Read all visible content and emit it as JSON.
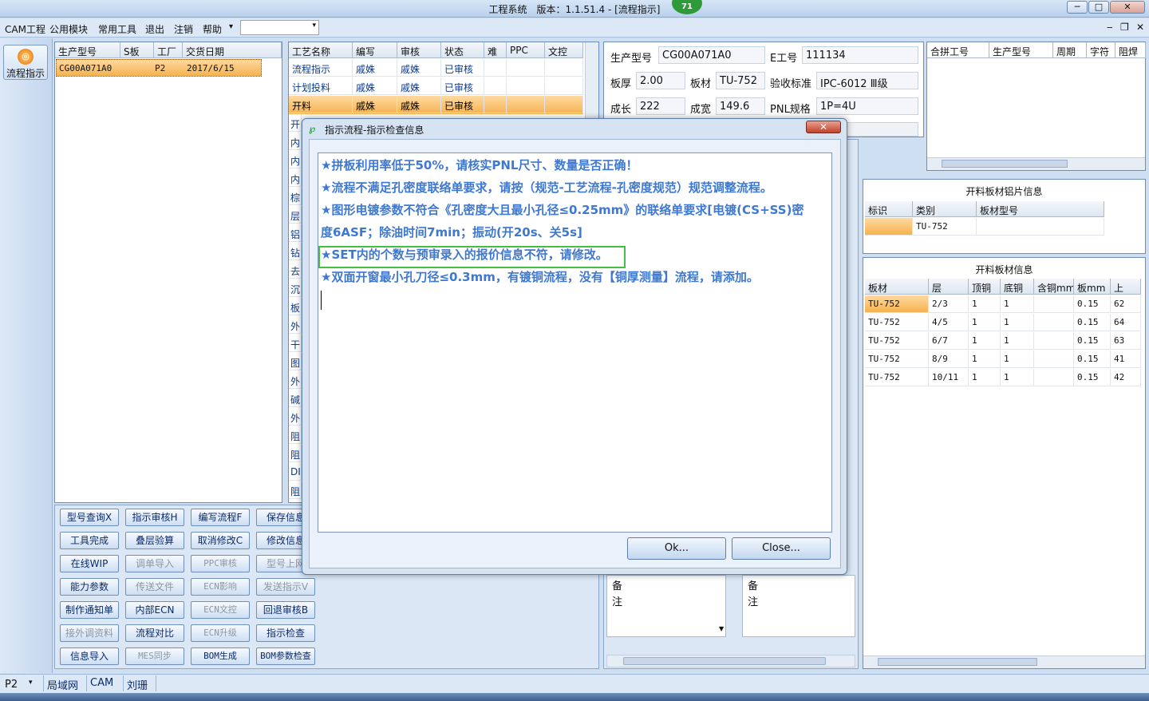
{
  "window": {
    "title": "工程系统　版本：1.1.51.4 - [流程指示]",
    "badge": "71",
    "controls": [
      "─",
      "□",
      "✕"
    ]
  },
  "menubar": {
    "items": [
      "CAM工程",
      "公用模块",
      "常用工具",
      "退出",
      "注销",
      "帮助"
    ],
    "help_arrow": "▾",
    "combo_value": "",
    "mdi_controls": [
      "‒",
      "❐",
      "✕"
    ]
  },
  "sidebar": {
    "flow_button": "流程指示"
  },
  "order_list": {
    "headers": [
      "生产型号",
      "S板",
      "工厂",
      "交货日期"
    ],
    "rows": [
      [
        "CG00A071A0",
        "",
        "P2",
        "2017/6/15"
      ]
    ]
  },
  "process_list": {
    "headers": [
      "工艺名称",
      "编写",
      "审核",
      "状态",
      "难",
      "PPC",
      "文控"
    ],
    "rows": [
      [
        "流程指示",
        "戚姝",
        "戚姝",
        "已审核"
      ],
      [
        "计划投料",
        "戚姝",
        "戚姝",
        "已审核"
      ],
      [
        "开料",
        "戚姝",
        "戚姝",
        "已审核"
      ]
    ],
    "more_rows": [
      "开",
      "内",
      "内",
      "内",
      "棕",
      "层",
      "铝",
      "钻",
      "去",
      "沉",
      "板",
      "外",
      "干",
      "图",
      "外",
      "碱",
      "外",
      "阻",
      "阻",
      "DI",
      "阻"
    ]
  },
  "buttons": [
    [
      "型号查询X",
      "指示审核H",
      "编写流程F",
      "保存信息"
    ],
    [
      "工具完成",
      "叠层验算",
      "取消修改C",
      "修改信息"
    ],
    [
      "在线WIP",
      "调单导入",
      "PPC审核",
      "型号上网"
    ],
    [
      "能力参数",
      "传送文件",
      "ECN影响",
      "发送指示V"
    ],
    [
      "制作通知单",
      "内部ECN",
      "ECN文控",
      "回退审核B"
    ],
    [
      "接外调资料",
      "流程对比",
      "ECN升级",
      "指示检查"
    ],
    [
      "信息导入",
      "MES同步",
      "BOM生成",
      "BOM参数检查"
    ]
  ],
  "info": {
    "model_label": "生产型号",
    "model": "CG00A071A0",
    "e_label": "E工号",
    "e_no": "111134",
    "thick_label": "板厚",
    "thick": "2.00",
    "mat_label": "板材",
    "mat": "TU-752",
    "std_label": "验收标准",
    "std": "IPC-6012 Ⅲ级",
    "len_label": "成长",
    "len": "222",
    "wid_label": "成宽",
    "wid": "149.6",
    "pnl_label": "PNL规格",
    "pnl": "1P=4U",
    "remark_label": "备注"
  },
  "merge_table": {
    "headers": [
      "合拼工号",
      "生产型号",
      "周期",
      "字符",
      "阻焊"
    ]
  },
  "al_sheet": {
    "title": "开料板材铝片信息",
    "headers": [
      "标识",
      "类别",
      "板材型号"
    ],
    "rows": [
      [
        "",
        "TU-752",
        ""
      ]
    ]
  },
  "board_info": {
    "title": "开料板材信息",
    "headers": [
      "板材",
      "层",
      "顶铜",
      "底铜",
      "含铜mm",
      "板mm",
      "上"
    ],
    "rows": [
      [
        "TU-752",
        "2/3",
        "1",
        "1",
        "",
        "0.15",
        "62"
      ],
      [
        "TU-752",
        "4/5",
        "1",
        "1",
        "",
        "0.15",
        "64"
      ],
      [
        "TU-752",
        "6/7",
        "1",
        "1",
        "",
        "0.15",
        "63"
      ],
      [
        "TU-752",
        "8/9",
        "1",
        "1",
        "",
        "0.15",
        "41"
      ],
      [
        "TU-752",
        "10/11",
        "1",
        "1",
        "",
        "0.15",
        "42"
      ]
    ]
  },
  "dialog": {
    "title": "指示流程-指示检查信息",
    "close_glyph": "✕",
    "messages": [
      "★拼板利用率低于50%，请核实PNL尺寸、数量是否正确！",
      "★流程不满足孔密度联络单要求，请按（规范-工艺流程-孔密度规范）规范调整流程。",
      "★图形电镀参数不符合《孔密度大且最小孔径≤0.25mm》的联络单要求[电镀(CS+SS)密",
      "度6ASF；除油时间7min；振动(开20s、关5s]",
      "★SET内的个数与预审录入的报价信息不符，请修改。",
      "★双面开窗最小孔刀径≤0.3mm，有镀铜流程，没有【铜厚测量】流程，请添加。"
    ],
    "ok": "Ok...",
    "close": "Close..."
  },
  "status": {
    "factory": "P2",
    "items": [
      "局域网",
      "CAM",
      "刘珊"
    ]
  }
}
